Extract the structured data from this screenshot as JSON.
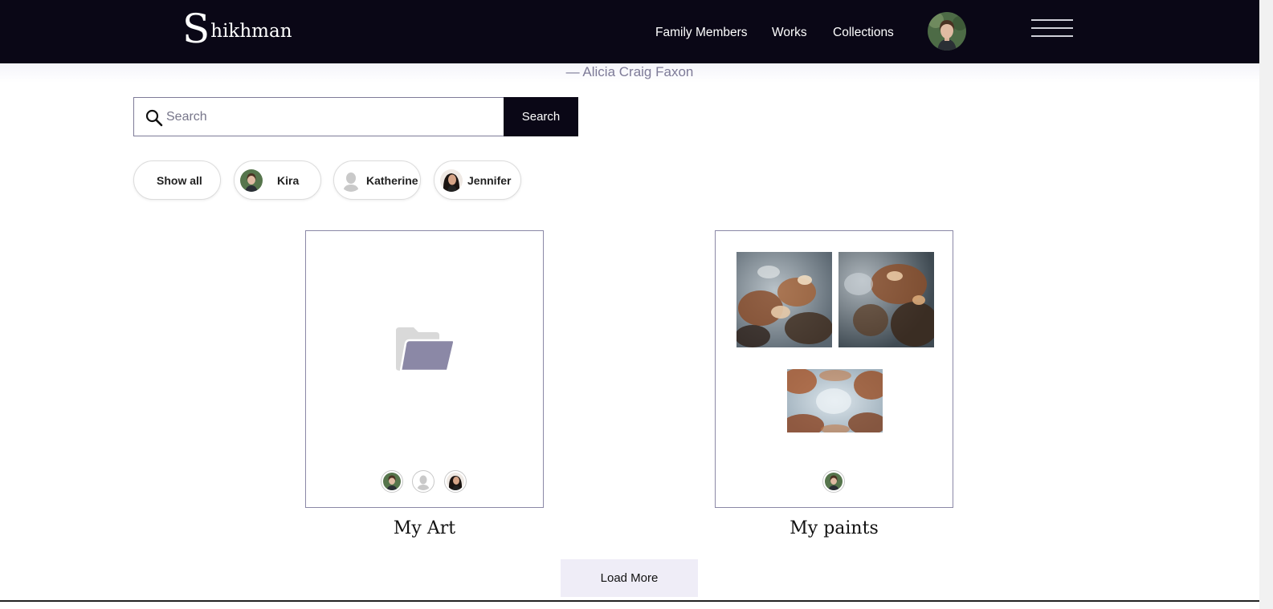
{
  "header": {
    "logo_initial": "S",
    "logo_rest": "hikhman",
    "nav": [
      "Family Members",
      "Works",
      "Collections"
    ],
    "avatar_icon": "user-avatar-icon",
    "menu_icon": "hamburger-menu-icon"
  },
  "quote_attribution": "— Alicia Craig Faxon",
  "search": {
    "placeholder": "Search",
    "button_label": "Search",
    "icon": "search-icon"
  },
  "filters": [
    {
      "label": "Show all",
      "avatar": null
    },
    {
      "label": "Kira",
      "avatar": "photo-avatar"
    },
    {
      "label": "Katherine",
      "avatar": "placeholder-avatar"
    },
    {
      "label": "Jennifer",
      "avatar": "photo-avatar"
    }
  ],
  "collections": [
    {
      "title": "My Art",
      "cover": "folder-icon",
      "members": [
        "Kira",
        "Katherine",
        "Jennifer"
      ]
    },
    {
      "title": "My paints",
      "cover": "painting-thumbnails",
      "members": [
        "Kira"
      ]
    }
  ],
  "load_more_label": "Load More",
  "colors": {
    "header_bg": "#0a0716",
    "accent_muted": "#7e7b98",
    "load_more_bg": "#efedf7",
    "folder": "#8b88a6"
  }
}
